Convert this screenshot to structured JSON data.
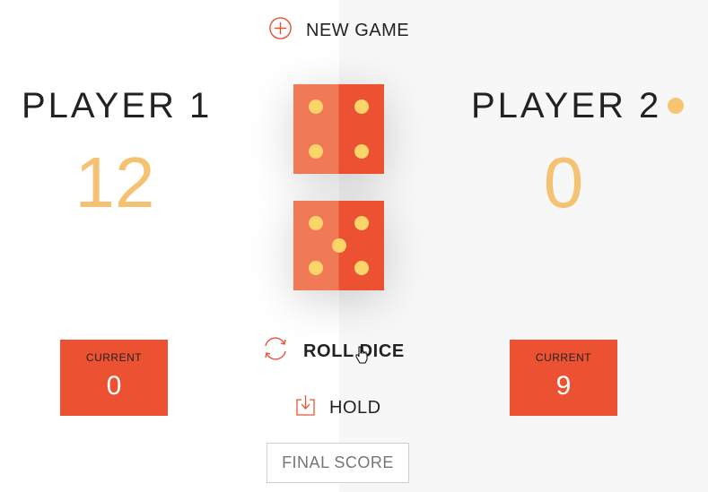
{
  "buttons": {
    "new_game": "NEW GAME",
    "roll_dice": "ROLL DICE",
    "hold": "HOLD"
  },
  "final_score": {
    "placeholder": "FINAL SCORE"
  },
  "players": [
    {
      "name": "PLAYER 1",
      "score": "12",
      "current_label": "CURRENT",
      "current_value": "0"
    },
    {
      "name": "PLAYER 2",
      "score": "0",
      "current_label": "CURRENT",
      "current_value": "9"
    }
  ],
  "active_player": 2,
  "dice": [
    4,
    5
  ],
  "colors": {
    "accent": "#ec5132",
    "accent_light": "#ef7a55",
    "score": "#f4c272",
    "pip": "#fbd56a",
    "active_dot": "#f8c471"
  },
  "icons": {
    "new_game": "plus-circle-icon",
    "roll_dice": "refresh-icon",
    "hold": "download-icon",
    "cursor": "hand-pointer-cursor"
  }
}
